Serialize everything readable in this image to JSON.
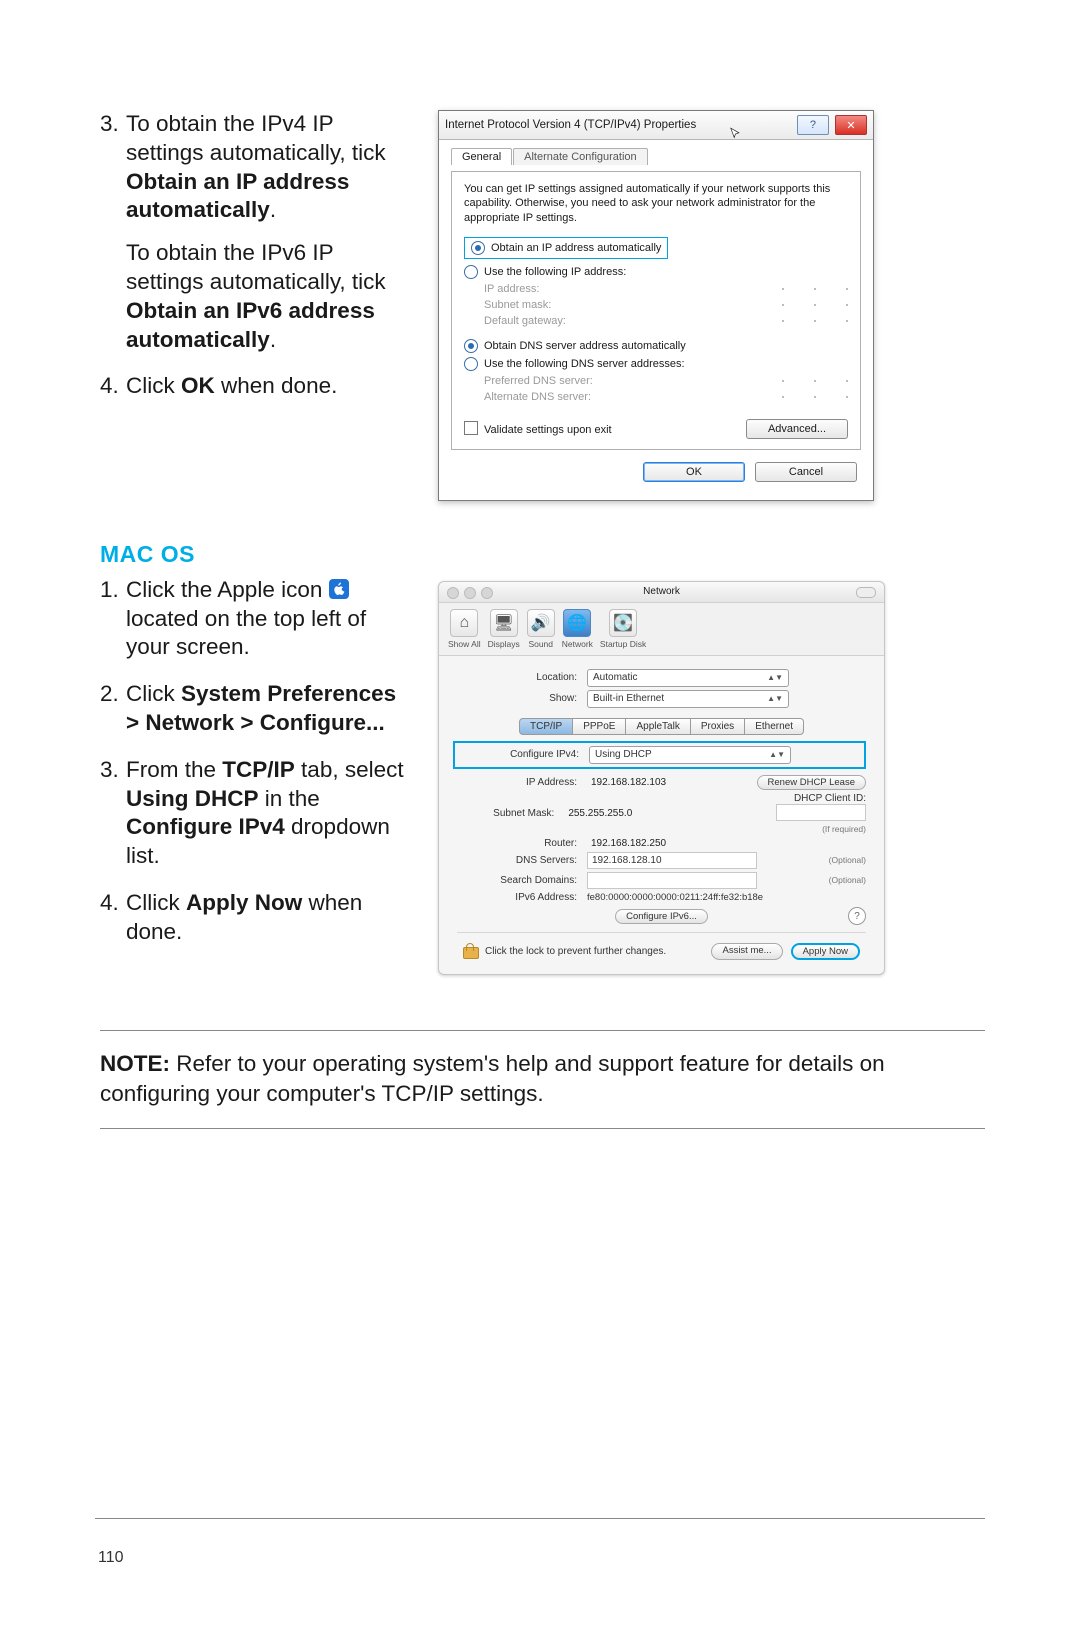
{
  "steps_a": {
    "s3": {
      "num": "3.",
      "line1": "To obtain the IPv4 IP settings automatically, tick ",
      "bold1": "Obtain an IP address automatically",
      "tail1": ".",
      "line2a": "To obtain the IPv6 IP settings automatically, tick ",
      "bold2": "Obtain an IPv6 address automatically",
      "tail2": "."
    },
    "s4": {
      "num": "4.",
      "t": "Click ",
      "b": "OK",
      "t2": " when done."
    }
  },
  "mac_heading": "MAC OS",
  "steps_b": {
    "s1": {
      "num": "1.",
      "t1": "Click the Apple icon ",
      "t2": " located on the top left of your screen."
    },
    "s2": {
      "num": "2.",
      "t": "Click ",
      "b": "System Preferences > Network > Configure..."
    },
    "s3": {
      "num": "3.",
      "t1": "From the ",
      "b1": "TCP/IP",
      "t2": " tab, select ",
      "b2": "Using DHCP",
      "t3": " in the ",
      "b3": "Configure IPv4",
      "t4": " dropdown list."
    },
    "s4": {
      "num": "4.",
      "t": "Cllick ",
      "b": "Apply Now",
      "t2": " when done."
    }
  },
  "note": {
    "label": "NOTE:",
    "text": " Refer to your operating system's help and support feature for details on configuring your computer's TCP/IP settings."
  },
  "page_number": "110",
  "win": {
    "title": "Internet Protocol Version 4 (TCP/IPv4) Properties",
    "help": "?",
    "close": "✕",
    "tabs": {
      "general": "General",
      "alt": "Alternate Configuration"
    },
    "desc": "You can get IP settings assigned automatically if your network supports this capability. Otherwise, you need to ask your network administrator for the appropriate IP settings.",
    "r_auto_ip": "Obtain an IP address automatically",
    "r_use_ip": "Use the following IP address:",
    "f_ip": "IP address:",
    "f_mask": "Subnet mask:",
    "f_gw": "Default gateway:",
    "r_auto_dns": "Obtain DNS server address automatically",
    "r_use_dns": "Use the following DNS server addresses:",
    "f_pref_dns": "Preferred DNS server:",
    "f_alt_dns": "Alternate DNS server:",
    "chk_validate": "Validate settings upon exit",
    "btn_adv": "Advanced...",
    "btn_ok": "OK",
    "btn_cancel": "Cancel"
  },
  "mac": {
    "title": "Network",
    "tools": {
      "showall": "Show All",
      "displays": "Displays",
      "sound": "Sound",
      "network": "Network",
      "startup": "Startup Disk"
    },
    "loc_label": "Location:",
    "loc_val": "Automatic",
    "show_label": "Show:",
    "show_val": "Built-in Ethernet",
    "tabs": {
      "tcpip": "TCP/IP",
      "pppoe": "PPPoE",
      "appletalk": "AppleTalk",
      "proxies": "Proxies",
      "ethernet": "Ethernet"
    },
    "cfg_label": "Configure IPv4:",
    "cfg_val": "Using DHCP",
    "ip_label": "IP Address:",
    "ip_val": "192.168.182.103",
    "renew": "Renew DHCP Lease",
    "mask_label": "Subnet Mask:",
    "mask_val": "255.255.255.0",
    "client_label": "DHCP Client ID:",
    "if_required": "(If required)",
    "router_label": "Router:",
    "router_val": "192.168.182.250",
    "dns_label": "DNS Servers:",
    "dns_val": "192.168.128.10",
    "optional": "(Optional)",
    "search_label": "Search Domains:",
    "ipv6_label": "IPv6 Address:",
    "ipv6_val": "fe80:0000:0000:0000:0211:24ff:fe32:b18e",
    "cfg6_btn": "Configure IPv6...",
    "lock_text": "Click the lock to prevent further changes.",
    "assist": "Assist me...",
    "apply": "Apply Now"
  }
}
